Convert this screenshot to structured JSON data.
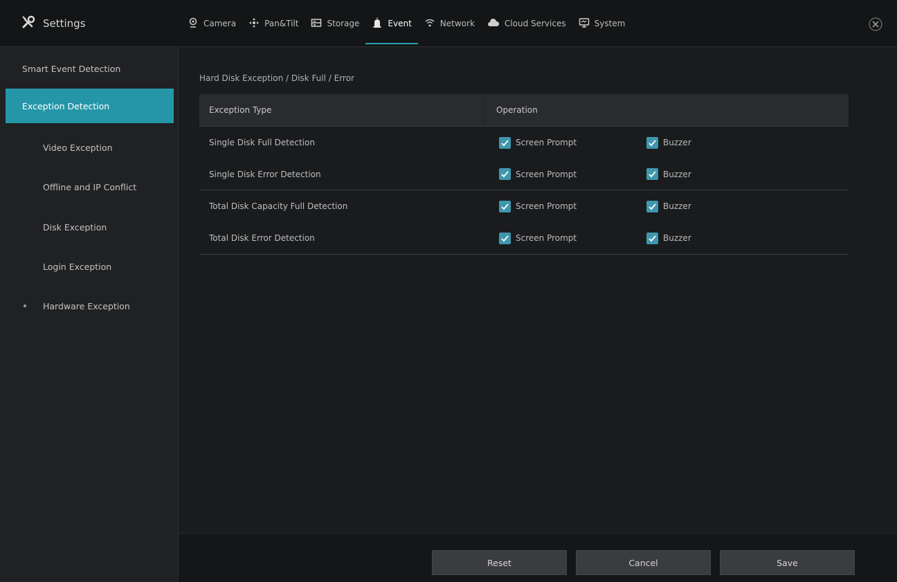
{
  "app": {
    "title": "Settings",
    "icon": "tools-icon"
  },
  "nav": {
    "tabs": [
      {
        "label": "Camera",
        "icon": "camera-icon"
      },
      {
        "label": "Pan&Tilt",
        "icon": "pan-tilt-icon"
      },
      {
        "label": "Storage",
        "icon": "storage-icon"
      },
      {
        "label": "Event",
        "icon": "alarm-icon"
      },
      {
        "label": "Network",
        "icon": "network-icon"
      },
      {
        "label": "Cloud Services",
        "icon": "cloud-icon"
      },
      {
        "label": "System",
        "icon": "monitor-icon"
      }
    ],
    "active_index": 3
  },
  "sidebar": {
    "items": [
      {
        "label": "Smart Event Detection"
      },
      {
        "label": "Exception Detection"
      },
      {
        "label": "Video Exception"
      },
      {
        "label": "Offline and IP Conflict"
      },
      {
        "label": "Disk Exception"
      },
      {
        "label": "Login Exception"
      },
      {
        "label": "Hardware Exception"
      }
    ]
  },
  "main": {
    "section_title": "Hard Disk Exception / Disk Full / Error",
    "table": {
      "headers": [
        "Exception Type",
        "Operation"
      ],
      "rows": [
        {
          "type": "Single Disk Full Detection",
          "op1": "Screen Prompt",
          "op2": "Buzzer"
        },
        {
          "type": "Single Disk Error Detection",
          "op1": "Screen Prompt",
          "op2": "Buzzer"
        },
        {
          "type": "Total Disk Capacity Full Detection",
          "op1": "Screen Prompt",
          "op2": "Buzzer"
        },
        {
          "type": "Total Disk Error Detection",
          "op1": "Screen Prompt",
          "op2": "Buzzer"
        }
      ]
    }
  },
  "footer": {
    "buttons": [
      "Reset",
      "Cancel",
      "Save"
    ]
  },
  "colors": {
    "accent": "#2596a8",
    "checkbox": "#3f97ad",
    "background": "#1a1b1d",
    "sidebar": "#202123"
  }
}
